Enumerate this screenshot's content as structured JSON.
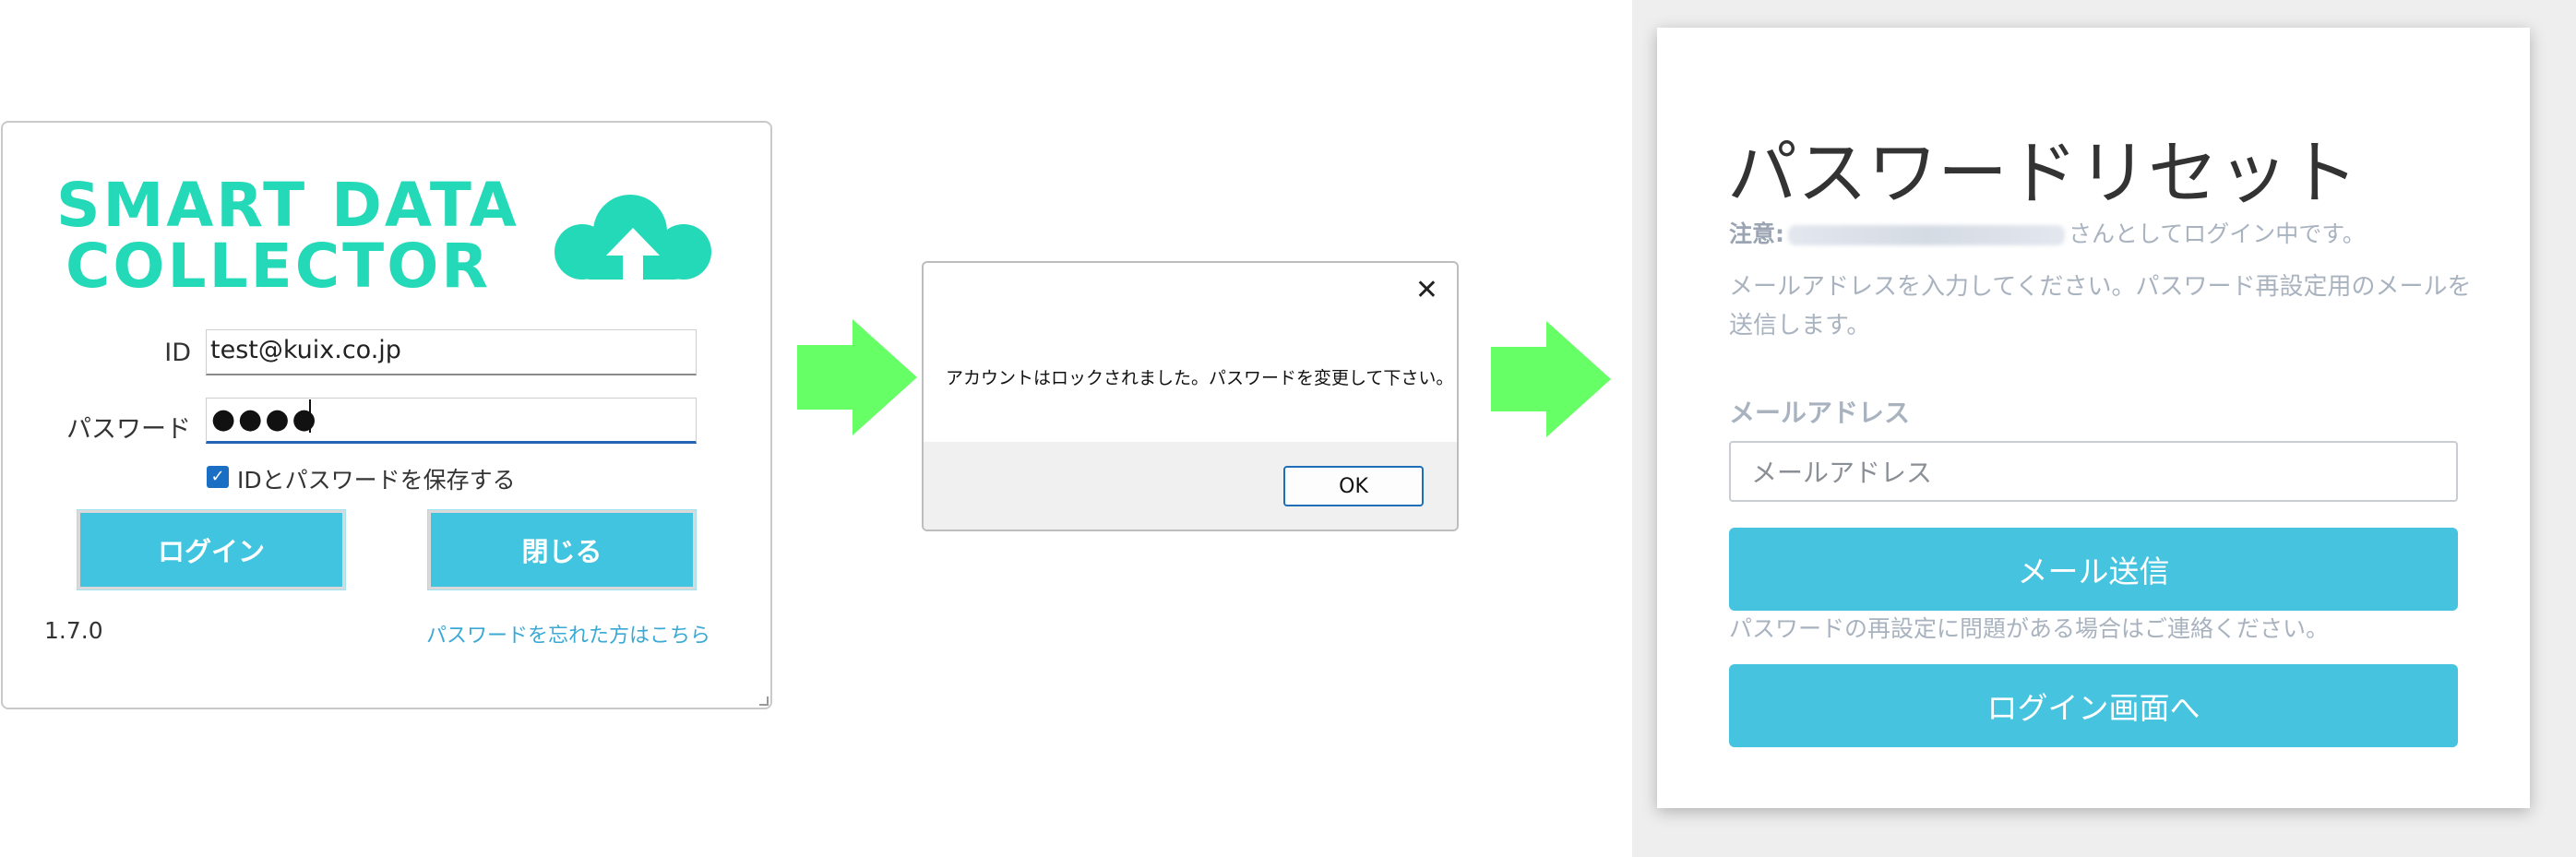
{
  "login": {
    "logo_text_line1": "SMART DATA",
    "logo_text_line2": "COLLECTOR",
    "id_label": "ID",
    "id_value": "test@kuix.co.jp",
    "password_label": "パスワード",
    "password_masked": "●●●●",
    "save_checkbox_label": "IDとパスワードを保存する",
    "save_checked": true,
    "login_button": "ログイン",
    "close_button": "閉じる",
    "version": "1.7.0",
    "forgot_link": "パスワードを忘れた方はこちら",
    "brand_color": "#23d9b7",
    "button_color": "#41c4df"
  },
  "dialog": {
    "close_glyph": "✕",
    "message": "アカウントはロックされました。パスワードを変更して下さい。",
    "ok_button": "OK"
  },
  "reset": {
    "title": "パスワードリセット",
    "notice_label": "注意:",
    "notice_suffix": "さんとしてログイン中です。",
    "instructions": "メールアドレスを入力してください。パスワード再設定用のメールを送信します。",
    "email_label": "メールアドレス",
    "email_placeholder": "メールアドレス",
    "send_button": "メール送信",
    "contact_note": "パスワードの再設定に問題がある場合はご連絡ください。",
    "back_button": "ログイン画面へ",
    "accent_color": "#45c3df"
  },
  "arrow_color": "#66ff66"
}
